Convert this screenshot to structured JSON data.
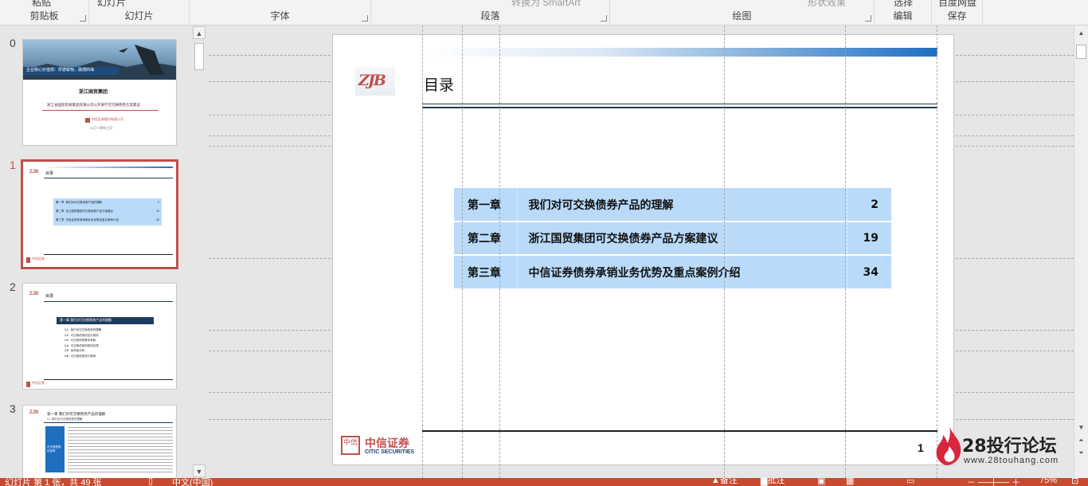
{
  "ribbon": {
    "groups": [
      {
        "label": "剪贴板",
        "top_stub": "粘贴"
      },
      {
        "label": "幻灯片",
        "top_stub": "幻灯片"
      },
      {
        "label": "字体",
        "top_stub": ""
      },
      {
        "label": "段落",
        "top_stub": "转换为 SmartArt"
      },
      {
        "label": "绘图",
        "top_stub": "形状效果"
      },
      {
        "label": "编辑",
        "top_stub": "选择"
      },
      {
        "label": "保存",
        "top_stub": "百度网盘"
      }
    ]
  },
  "thumbnails": {
    "items": [
      {
        "number": "0",
        "kind": "cover"
      },
      {
        "number": "1",
        "kind": "toc",
        "selected": true
      },
      {
        "number": "2",
        "kind": "chapter"
      },
      {
        "number": "3",
        "kind": "content"
      }
    ],
    "cover_banner_text": "企业核心价值观：厚德载物，融通四海",
    "cover_org": "浙江国贸集团",
    "cover_subtitle": "浙江省国际贸易集团有限公司公开发行可交换债券方案建议",
    "cover_logo_text": "中信证券股份有限公司",
    "cover_date": "二〇一四年三月",
    "mini_title": "目录",
    "mini_chapter_bar": "第一章  我们对可交换债券产品的理解",
    "mini_chapter_items": [
      {
        "num": "1.1",
        "text": "我们对可交换债券的理解"
      },
      {
        "num": "1.2",
        "text": "可交换债券的定价原则"
      },
      {
        "num": "1.3",
        "text": "可交换债券基本条款"
      },
      {
        "num": "1.4",
        "text": "可交换债券的税收处理"
      },
      {
        "num": "1.5",
        "text": "投资者分析"
      },
      {
        "num": "1.6",
        "text": "可交换债券发行案例"
      }
    ],
    "content_title": "第一章 我们对可交换债券产品的理解",
    "content_subtitle": "1.1 我们对可交换债券的理解",
    "content_side_label": "可交换债券的优势"
  },
  "slide": {
    "title": "目录",
    "company_logo_text": "ZJB",
    "footer_logo_cn": "中信证券",
    "footer_logo_en": "CITIC SECURITIES",
    "footer_badge": "中信",
    "page_number": "1",
    "toc": [
      {
        "chapter": "第一章",
        "title": "我们对可交换债券产品的理解",
        "page": "2"
      },
      {
        "chapter": "第二章",
        "title": "浙江国贸集团可交换债券产品方案建议",
        "page": "19"
      },
      {
        "chapter": "第三章",
        "title": "中信证券债券承销业务优势及重点案例介绍",
        "page": "34"
      }
    ]
  },
  "watermark": {
    "name": "28投行论坛",
    "url": "www.28touhang.com"
  },
  "statusbar": {
    "slide_info": "幻灯片 第 1 张，共 49 张",
    "language": "中文(中国)",
    "notes": "备注",
    "comments": "批注",
    "zoom": "75%"
  },
  "colors": {
    "accent": "#c0504d",
    "toc_fill": "#b9dbf9",
    "slide_rule": "#1f3d4a",
    "title_gradient_end": "#1f6fc1"
  }
}
